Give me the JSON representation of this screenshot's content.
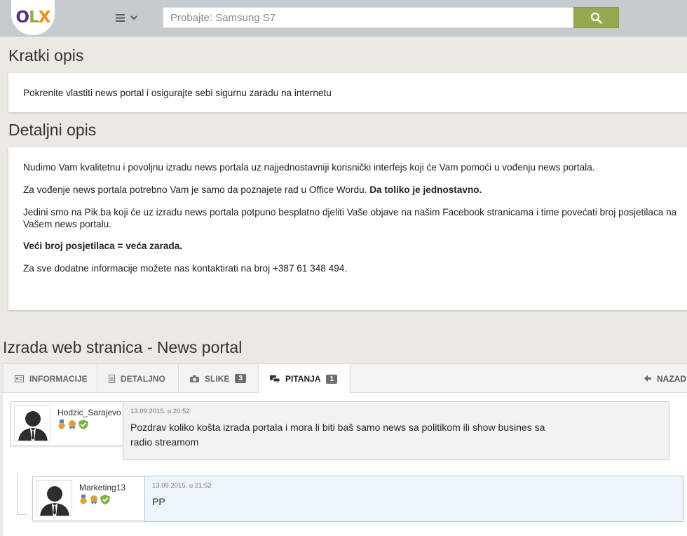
{
  "header": {
    "logo": {
      "letter1": "O",
      "letter2": "L",
      "letter3": "X",
      "color1": "#5b2d86",
      "color2": "#8bb33c",
      "color3": "#f08d1c"
    },
    "menu_icon": "hamburger-icon",
    "search": {
      "placeholder": "Probajte: Samsung S7",
      "value": ""
    }
  },
  "short_description": {
    "heading": "Kratki opis",
    "text": "Pokrenite vlastiti news portal i osigurajte sebi sigurnu zaradu na internetu"
  },
  "detailed_description": {
    "heading": "Detaljni opis",
    "p1": "Nudimo Vam kvalitetnu i povoljnu izradu news portala uz najjednostavniji korisnički interfejs koji će Vam pomoći u vođenju news portala.",
    "p2_normal": "Za vođenje news portala potrebno Vam je samo da poznajete rad u Office Wordu. ",
    "p2_bold": "Da toliko je jednostavno.",
    "p3": "Jedini smo na Pik.ba koji će uz izradu news portala potpuno besplatno djeliti Vaše objave na našim Facebook stranicama i time povećati broj posjetilaca na Vašem news portalu.",
    "p4_bold": "Veći broj posjetilaca = veća zarada.",
    "p5": "Za sve dodatne informacije možete nas kontaktirati na broj +387 61 348 494."
  },
  "ad_title": "Izrada web stranica - News portal",
  "tabs": [
    {
      "label": "INFORMACIJE",
      "icon": "id-card-icon"
    },
    {
      "label": "DETALJNO",
      "icon": "document-icon"
    },
    {
      "label": "SLIKE",
      "icon": "camera-icon",
      "badge": "3"
    },
    {
      "label": "PITANJA",
      "icon": "chat-icon",
      "badge": "1"
    }
  ],
  "back_label": "NAZAD",
  "questions": [
    {
      "username": "Hodzic_Sarajevo",
      "timestamp": "13.09.2015. u 20:52",
      "text_line1": "Pozdrav koliko košta izrada portala i mora li biti baš samo news sa politikom ili show busines sa",
      "text_line2": "radio streamom"
    },
    {
      "username": "Marketing13",
      "timestamp": "13.09.2015. u 21:52",
      "text_line1": "PP"
    }
  ],
  "colors": {
    "search_button": "#97a94f",
    "reply_bubble": "#eef4fb",
    "badge_gold": "#d9a23b",
    "badge_green": "#7cb342"
  }
}
